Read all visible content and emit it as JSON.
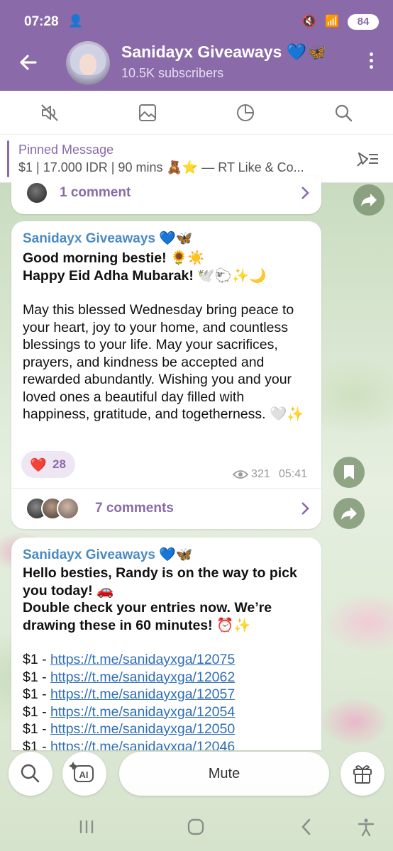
{
  "status": {
    "time": "07:28",
    "battery": "84"
  },
  "header": {
    "title": "Sanidayx Giveaways 💙🦋",
    "subtitle": "10.5K subscribers"
  },
  "pinned": {
    "title": "Pinned Message",
    "text": "$1 | 17.000 IDR | 90 mins 🧸⭐ — RT Like & Co..."
  },
  "messages": [
    {
      "comments": "1 comment"
    },
    {
      "sender": "Sanidayx Giveaways 💙🦋",
      "line1": "Good morning bestie! 🌻☀️",
      "line2": "Happy Eid Adha Mubarak! 🕊️🐑✨🌙",
      "body": "May this blessed Wednesday bring peace to your heart, joy to your home, and countless blessings to your life. May your sacrifices, prayers, and kindness be accepted and rewarded abundantly. Wishing you and your loved ones a beautiful day filled with happiness, gratitude, and togetherness. 🤍✨",
      "reaction_emoji": "❤️",
      "reaction_count": "28",
      "views": "321",
      "time": "05:41",
      "comments": "7 comments"
    },
    {
      "sender": "Sanidayx Giveaways 💙🦋",
      "line1": "Hello besties, Randy is on the way to pick you today! 🚗",
      "line2": "Double check your entries now. We’re drawing these in 60 minutes! ⏰✨",
      "entries": [
        {
          "prefix": "$1 - ",
          "link": "https://t.me/sanidayxga/12075"
        },
        {
          "prefix": "$1 - ",
          "link": "https://t.me/sanidayxga/12062"
        },
        {
          "prefix": "$1 - ",
          "link": "https://t.me/sanidayxga/12057"
        },
        {
          "prefix": "$1 - ",
          "link": "https://t.me/sanidayxga/12054"
        },
        {
          "prefix": "$1 - ",
          "link": "https://t.me/sanidayxga/12050"
        },
        {
          "prefix": "$1 - ",
          "link": "https://t.me/sanidayxga/12046"
        }
      ]
    }
  ],
  "bottom": {
    "mute_label": "Mute"
  },
  "colors": {
    "header": "#8a6aa8",
    "accent": "#8a6aa8",
    "sender": "#4a8ac4",
    "link": "#2f6fb6"
  },
  "icons": [
    "back-arrow-icon",
    "mute-audio-icon",
    "image-icon",
    "chart-icon",
    "search-icon",
    "unpin-icon",
    "forward-icon",
    "bookmark-icon",
    "ai-icon",
    "gift-icon"
  ]
}
